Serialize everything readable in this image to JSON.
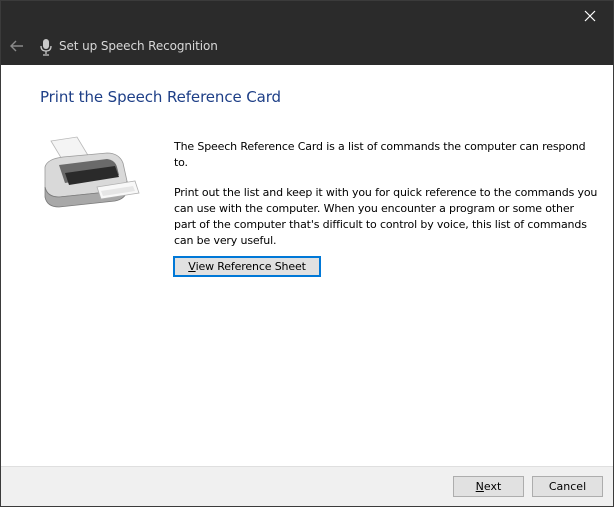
{
  "window": {
    "title": "Set up Speech Recognition",
    "colors": {
      "titlebar": "#2b2b2b",
      "heading": "#1e3f87",
      "accent": "#0078d7"
    }
  },
  "icons": {
    "close": "close-icon",
    "back": "back-arrow-icon",
    "mic": "microphone-icon",
    "printer": "printer-icon"
  },
  "content": {
    "heading": "Print the Speech Reference Card",
    "paragraph1": "The Speech Reference Card is a list of commands the computer can respond to.",
    "paragraph2": "Print out the list and keep it with you for quick reference to the commands you can use with the computer. When you encounter a program or some other part of the computer that's difficult to control by voice, this list of commands can be very useful.",
    "view_button": {
      "accel": "V",
      "rest": "iew Reference Sheet"
    }
  },
  "footer": {
    "next": {
      "accel": "N",
      "rest": "ext"
    },
    "cancel": "Cancel"
  }
}
